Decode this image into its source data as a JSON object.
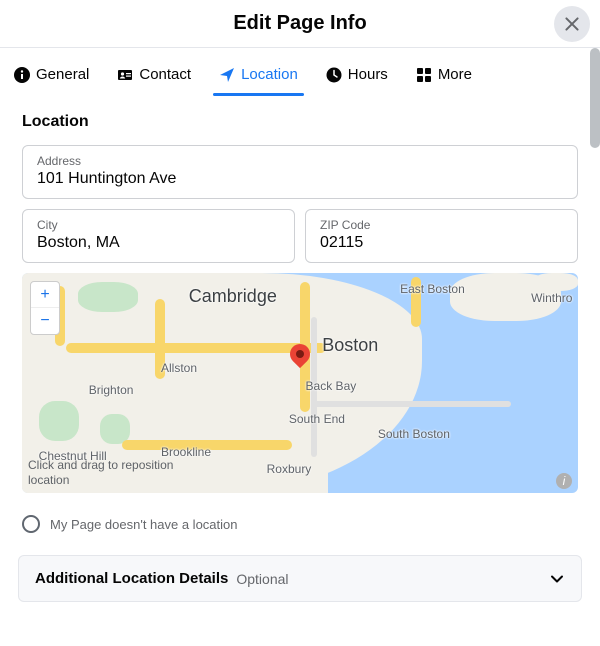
{
  "header": {
    "title": "Edit Page Info"
  },
  "tabs": {
    "general": "General",
    "contact": "Contact",
    "location": "Location",
    "hours": "Hours",
    "more": "More"
  },
  "section": {
    "title": "Location",
    "address_label": "Address",
    "address_value": "101 Huntington Ave",
    "city_label": "City",
    "city_value": "Boston, MA",
    "zip_label": "ZIP Code",
    "zip_value": "02115"
  },
  "map": {
    "labels": {
      "cambridge": "Cambridge",
      "east_boston": "East Boston",
      "winthrop": "Winthro",
      "boston": "Boston",
      "allston": "Allston",
      "brighton": "Brighton",
      "back_bay": "Back Bay",
      "south_end": "South End",
      "south_boston": "South Boston",
      "roxbury": "Roxbury",
      "brookline": "Brookline",
      "chestnut_hill": "Chestnut Hill"
    },
    "hint": "Click and drag to reposition location",
    "zoom_in": "+",
    "zoom_out": "−",
    "attr": "i"
  },
  "no_location_label": "My Page doesn't have a location",
  "accordion": {
    "title": "Additional Location Details",
    "subtitle": "Optional"
  }
}
